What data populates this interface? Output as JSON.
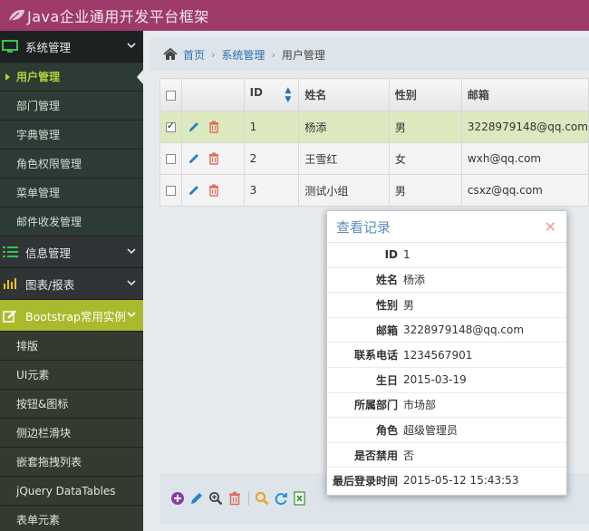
{
  "header": {
    "title": "Java企业通用开发平台框架"
  },
  "sidebar": {
    "group_system": "系统管理",
    "system_items": [
      "用户管理",
      "部门管理",
      "字典管理",
      "角色权限管理",
      "菜单管理",
      "邮件收发管理"
    ],
    "group_info": "信息管理",
    "group_charts": "图表/报表",
    "group_bootstrap": "Bootstrap常用实例",
    "bootstrap_items": [
      "排版",
      "UI元素",
      "按钮&图标",
      "侧边栏滑块",
      "嵌套拖拽列表",
      "jQuery DataTables",
      "表单元素"
    ]
  },
  "breadcrumb": {
    "home": "首页",
    "level1": "系统管理",
    "current": "用户管理"
  },
  "table": {
    "headers": {
      "id": "ID",
      "name": "姓名",
      "gender": "性别",
      "email": "邮箱"
    },
    "rows": [
      {
        "id": "1",
        "name": "杨添",
        "gender": "男",
        "email": "3228979148@qq.com"
      },
      {
        "id": "2",
        "name": "王雪红",
        "gender": "女",
        "email": "wxh@qq.com"
      },
      {
        "id": "3",
        "name": "测试小组",
        "gender": "男",
        "email": "csxz@qq.com"
      }
    ]
  },
  "modal": {
    "title": "查看记录",
    "close": "×",
    "fields": [
      {
        "label": "ID",
        "value": "1"
      },
      {
        "label": "姓名",
        "value": "杨添"
      },
      {
        "label": "性别",
        "value": "男"
      },
      {
        "label": "邮箱",
        "value": "3228979148@qq.com"
      },
      {
        "label": "联系电话",
        "value": "1234567901"
      },
      {
        "label": "生日",
        "value": "2015-03-19"
      },
      {
        "label": "所属部门",
        "value": "市场部"
      },
      {
        "label": "角色",
        "value": "超级管理员"
      },
      {
        "label": "是否禁用",
        "value": "否"
      },
      {
        "label": "最后登录时间",
        "value": "2015-05-12 15:43:53"
      }
    ]
  },
  "icons": {
    "logo": "leaf-icon",
    "home": "home-icon",
    "edit": "pencil-icon",
    "delete": "trash-icon",
    "add": "plus-circle-icon",
    "view": "zoom-in-icon",
    "search": "search-icon",
    "refresh": "refresh-icon",
    "export": "excel-icon"
  },
  "colors": {
    "header": "#9e3b6a",
    "accent": "#a9bb2c",
    "link": "#2a6fb0",
    "selected_row": "#dce9bf"
  }
}
